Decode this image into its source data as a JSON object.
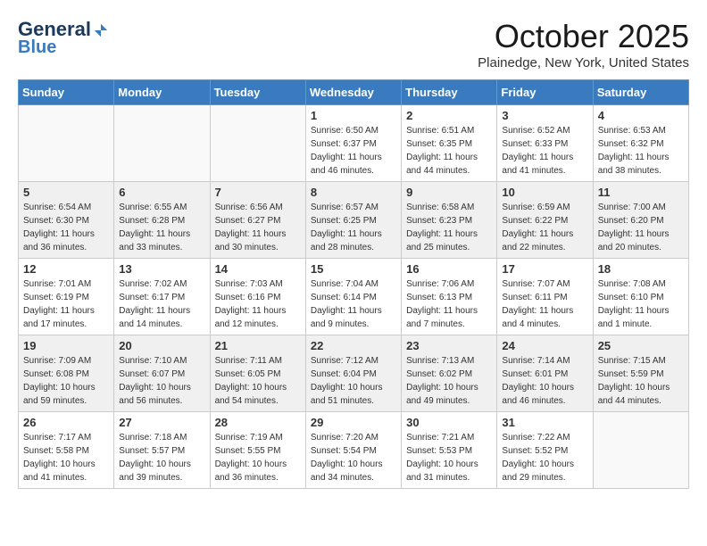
{
  "header": {
    "logo_general": "General",
    "logo_blue": "Blue",
    "month_title": "October 2025",
    "location": "Plainedge, New York, United States"
  },
  "days_of_week": [
    "Sunday",
    "Monday",
    "Tuesday",
    "Wednesday",
    "Thursday",
    "Friday",
    "Saturday"
  ],
  "weeks": [
    [
      {
        "day": "",
        "info": ""
      },
      {
        "day": "",
        "info": ""
      },
      {
        "day": "",
        "info": ""
      },
      {
        "day": "1",
        "info": "Sunrise: 6:50 AM\nSunset: 6:37 PM\nDaylight: 11 hours\nand 46 minutes."
      },
      {
        "day": "2",
        "info": "Sunrise: 6:51 AM\nSunset: 6:35 PM\nDaylight: 11 hours\nand 44 minutes."
      },
      {
        "day": "3",
        "info": "Sunrise: 6:52 AM\nSunset: 6:33 PM\nDaylight: 11 hours\nand 41 minutes."
      },
      {
        "day": "4",
        "info": "Sunrise: 6:53 AM\nSunset: 6:32 PM\nDaylight: 11 hours\nand 38 minutes."
      }
    ],
    [
      {
        "day": "5",
        "info": "Sunrise: 6:54 AM\nSunset: 6:30 PM\nDaylight: 11 hours\nand 36 minutes."
      },
      {
        "day": "6",
        "info": "Sunrise: 6:55 AM\nSunset: 6:28 PM\nDaylight: 11 hours\nand 33 minutes."
      },
      {
        "day": "7",
        "info": "Sunrise: 6:56 AM\nSunset: 6:27 PM\nDaylight: 11 hours\nand 30 minutes."
      },
      {
        "day": "8",
        "info": "Sunrise: 6:57 AM\nSunset: 6:25 PM\nDaylight: 11 hours\nand 28 minutes."
      },
      {
        "day": "9",
        "info": "Sunrise: 6:58 AM\nSunset: 6:23 PM\nDaylight: 11 hours\nand 25 minutes."
      },
      {
        "day": "10",
        "info": "Sunrise: 6:59 AM\nSunset: 6:22 PM\nDaylight: 11 hours\nand 22 minutes."
      },
      {
        "day": "11",
        "info": "Sunrise: 7:00 AM\nSunset: 6:20 PM\nDaylight: 11 hours\nand 20 minutes."
      }
    ],
    [
      {
        "day": "12",
        "info": "Sunrise: 7:01 AM\nSunset: 6:19 PM\nDaylight: 11 hours\nand 17 minutes."
      },
      {
        "day": "13",
        "info": "Sunrise: 7:02 AM\nSunset: 6:17 PM\nDaylight: 11 hours\nand 14 minutes."
      },
      {
        "day": "14",
        "info": "Sunrise: 7:03 AM\nSunset: 6:16 PM\nDaylight: 11 hours\nand 12 minutes."
      },
      {
        "day": "15",
        "info": "Sunrise: 7:04 AM\nSunset: 6:14 PM\nDaylight: 11 hours\nand 9 minutes."
      },
      {
        "day": "16",
        "info": "Sunrise: 7:06 AM\nSunset: 6:13 PM\nDaylight: 11 hours\nand 7 minutes."
      },
      {
        "day": "17",
        "info": "Sunrise: 7:07 AM\nSunset: 6:11 PM\nDaylight: 11 hours\nand 4 minutes."
      },
      {
        "day": "18",
        "info": "Sunrise: 7:08 AM\nSunset: 6:10 PM\nDaylight: 11 hours\nand 1 minute."
      }
    ],
    [
      {
        "day": "19",
        "info": "Sunrise: 7:09 AM\nSunset: 6:08 PM\nDaylight: 10 hours\nand 59 minutes."
      },
      {
        "day": "20",
        "info": "Sunrise: 7:10 AM\nSunset: 6:07 PM\nDaylight: 10 hours\nand 56 minutes."
      },
      {
        "day": "21",
        "info": "Sunrise: 7:11 AM\nSunset: 6:05 PM\nDaylight: 10 hours\nand 54 minutes."
      },
      {
        "day": "22",
        "info": "Sunrise: 7:12 AM\nSunset: 6:04 PM\nDaylight: 10 hours\nand 51 minutes."
      },
      {
        "day": "23",
        "info": "Sunrise: 7:13 AM\nSunset: 6:02 PM\nDaylight: 10 hours\nand 49 minutes."
      },
      {
        "day": "24",
        "info": "Sunrise: 7:14 AM\nSunset: 6:01 PM\nDaylight: 10 hours\nand 46 minutes."
      },
      {
        "day": "25",
        "info": "Sunrise: 7:15 AM\nSunset: 5:59 PM\nDaylight: 10 hours\nand 44 minutes."
      }
    ],
    [
      {
        "day": "26",
        "info": "Sunrise: 7:17 AM\nSunset: 5:58 PM\nDaylight: 10 hours\nand 41 minutes."
      },
      {
        "day": "27",
        "info": "Sunrise: 7:18 AM\nSunset: 5:57 PM\nDaylight: 10 hours\nand 39 minutes."
      },
      {
        "day": "28",
        "info": "Sunrise: 7:19 AM\nSunset: 5:55 PM\nDaylight: 10 hours\nand 36 minutes."
      },
      {
        "day": "29",
        "info": "Sunrise: 7:20 AM\nSunset: 5:54 PM\nDaylight: 10 hours\nand 34 minutes."
      },
      {
        "day": "30",
        "info": "Sunrise: 7:21 AM\nSunset: 5:53 PM\nDaylight: 10 hours\nand 31 minutes."
      },
      {
        "day": "31",
        "info": "Sunrise: 7:22 AM\nSunset: 5:52 PM\nDaylight: 10 hours\nand 29 minutes."
      },
      {
        "day": "",
        "info": ""
      }
    ]
  ]
}
